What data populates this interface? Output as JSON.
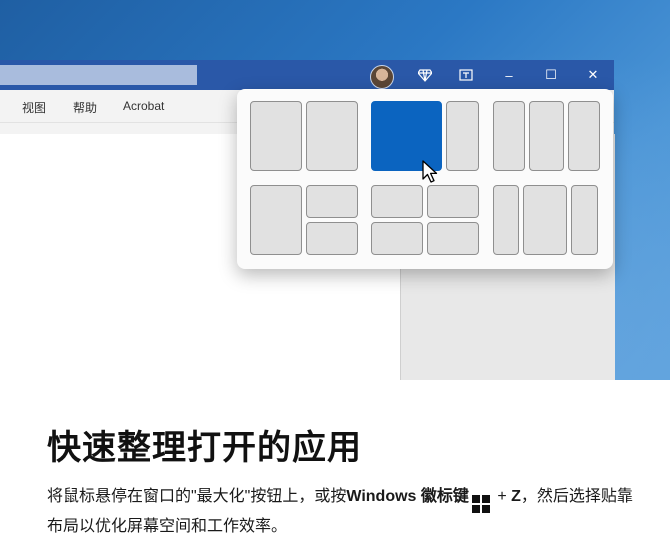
{
  "menu": {
    "view": "视图",
    "help": "帮助",
    "acrobat": "Acrobat"
  },
  "titlebar": {
    "icons": [
      "diamond-icon",
      "restore-icon",
      "minimize-icon",
      "maximize-icon",
      "close-icon"
    ],
    "minimize_glyph": "–",
    "maximize_glyph": "☐",
    "close_glyph": "✕"
  },
  "snap_layouts": {
    "selected_layout": 2,
    "selected_zone": 1,
    "accent": "#0b64c0"
  },
  "content": {
    "heading": "快速整理打开的应用",
    "desc_part1": "将鼠标悬停在窗口的\"最大化\"按钮上，或按",
    "desc_bold": "Windows 徽标键",
    "desc_part2": " + ",
    "desc_key": "Z",
    "desc_part3": "，然后选择贴靠布局以优化屏幕空间和工作效率。"
  }
}
